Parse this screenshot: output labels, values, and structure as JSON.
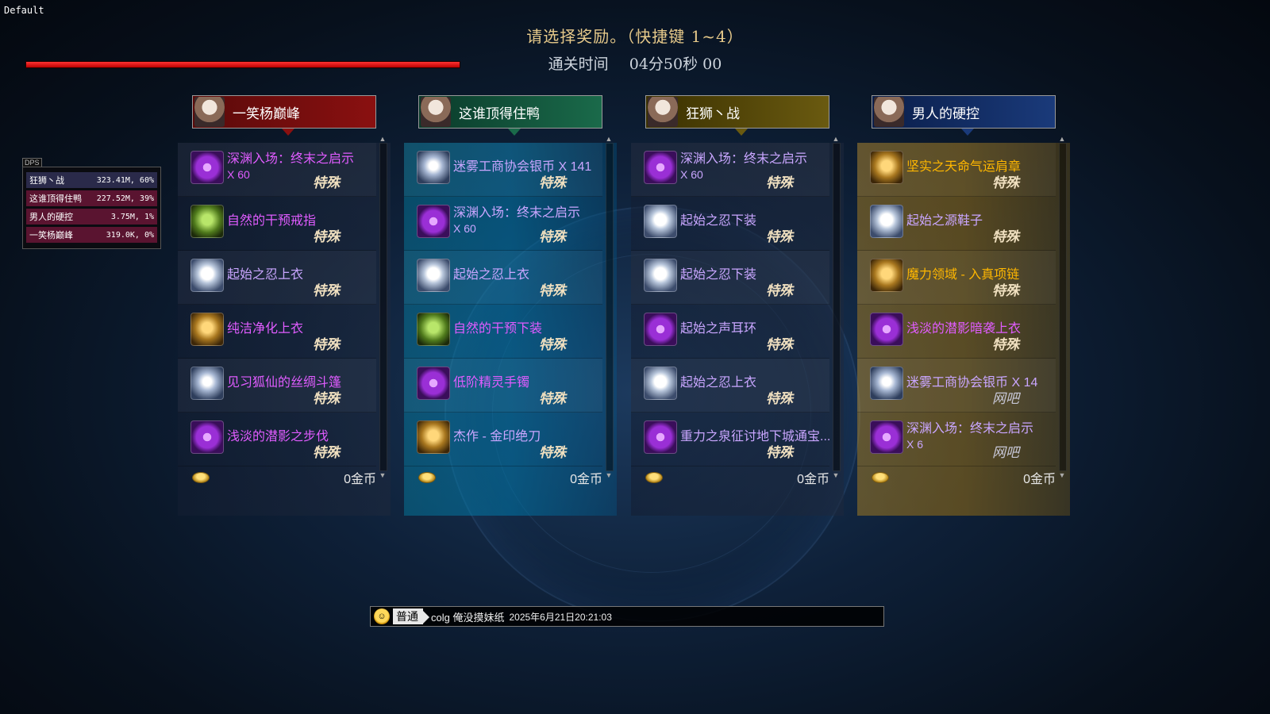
{
  "window_label": "Default",
  "hp_fill_percent": 100,
  "title": "请选择奖励。（快捷键 1~4）",
  "time_label": "通关时间",
  "time_value": "04分50秒 00",
  "dps": {
    "tag": "DPS",
    "rows": [
      {
        "name": "狂狮丶战",
        "value": "323.41M, 60%",
        "color": "#2a2a4a"
      },
      {
        "name": "这谁顶得住鸭",
        "value": "227.52M, 39%",
        "color": "#5a1430"
      },
      {
        "name": "男人的硬控",
        "value": "3.75M, 1%",
        "color": "#5a1430"
      },
      {
        "name": "一笑杨巅峰",
        "value": "319.0K, 0%",
        "color": "#5a1430"
      }
    ]
  },
  "columns": [
    {
      "player": "一笑杨巅峰",
      "head_bg": "#5a0a0a",
      "head_color": "#8a1010",
      "gold": "0金币",
      "items": [
        {
          "name": "深渊入场：终末之启示",
          "qty": "X 60",
          "color": "#e05cff",
          "tag": "特殊",
          "icon": "purple"
        },
        {
          "name": "自然的干预戒指",
          "qty": "",
          "color": "#e05cff",
          "tag": "特殊",
          "icon": "green"
        },
        {
          "name": "起始之忍上衣",
          "qty": "",
          "color": "#c9a6ff",
          "tag": "特殊",
          "icon": "white"
        },
        {
          "name": "纯洁净化上衣",
          "qty": "",
          "color": "#e05cff",
          "tag": "特殊",
          "icon": "gold"
        },
        {
          "name": "见习狐仙的丝绸斗篷",
          "qty": "",
          "color": "#e05cff",
          "tag": "特殊",
          "icon": "coin"
        },
        {
          "name": "浅淡的潜影之步伐",
          "qty": "",
          "color": "#e05cff",
          "tag": "特殊",
          "icon": "purple"
        }
      ]
    },
    {
      "player": "这谁顶得住鸭",
      "head_bg": "#0a3a2a",
      "head_color": "#1a6a4a",
      "gold": "0金币",
      "items": [
        {
          "name": "迷雾工商协会银币 X 141",
          "qty": "",
          "color": "#c9a6ff",
          "tag": "特殊",
          "icon": "coin"
        },
        {
          "name": "深渊入场：终末之启示",
          "qty": "X 60",
          "color": "#c9a6ff",
          "tag": "特殊",
          "icon": "purple"
        },
        {
          "name": "起始之忍上衣",
          "qty": "",
          "color": "#c9a6ff",
          "tag": "特殊",
          "icon": "white"
        },
        {
          "name": "自然的干预下装",
          "qty": "",
          "color": "#e05cff",
          "tag": "特殊",
          "icon": "green"
        },
        {
          "name": "低阶精灵手镯",
          "qty": "",
          "color": "#e05cff",
          "tag": "特殊",
          "icon": "purple"
        },
        {
          "name": "杰作 - 金印绝刀",
          "qty": "",
          "color": "#c9a6ff",
          "tag": "特殊",
          "icon": "gold"
        }
      ]
    },
    {
      "player": "狂狮丶战",
      "head_bg": "#3a3000",
      "head_color": "#6a5a10",
      "gold": "0金币",
      "items": [
        {
          "name": "深渊入场：终末之启示",
          "qty": "X 60",
          "color": "#c9a6ff",
          "tag": "特殊",
          "icon": "purple"
        },
        {
          "name": "起始之忍下装",
          "qty": "",
          "color": "#c9a6ff",
          "tag": "特殊",
          "icon": "white"
        },
        {
          "name": "起始之忍下装",
          "qty": "",
          "color": "#c9a6ff",
          "tag": "特殊",
          "icon": "white"
        },
        {
          "name": "起始之声耳环",
          "qty": "",
          "color": "#c9a6ff",
          "tag": "特殊",
          "icon": "purple"
        },
        {
          "name": "起始之忍上衣",
          "qty": "",
          "color": "#c9a6ff",
          "tag": "特殊",
          "icon": "white"
        },
        {
          "name": "重力之泉征讨地下城通宝...",
          "qty": "",
          "color": "#c9a6ff",
          "tag": "特殊",
          "icon": "purple"
        }
      ]
    },
    {
      "player": "男人的硬控",
      "head_bg": "#0a1e4a",
      "head_color": "#1a3a7a",
      "gold": "0金币",
      "items": [
        {
          "name": "坚实之天命气运肩章",
          "qty": "",
          "color": "#ffb700",
          "tag": "特殊",
          "icon": "gold"
        },
        {
          "name": "起始之源鞋子",
          "qty": "",
          "color": "#c9a6ff",
          "tag": "特殊",
          "icon": "white"
        },
        {
          "name": "魔力领域 - 入真项链",
          "qty": "",
          "color": "#ffb700",
          "tag": "特殊",
          "icon": "gold"
        },
        {
          "name": "浅淡的潜影暗袭上衣",
          "qty": "",
          "color": "#e05cff",
          "tag": "特殊",
          "icon": "purple"
        },
        {
          "name": "迷雾工商协会银币 X 14",
          "qty": "",
          "color": "#c9a6ff",
          "tag": "网吧",
          "icon": "coin"
        },
        {
          "name": "深渊入场：终末之启示",
          "qty": "X 6",
          "color": "#c9a6ff",
          "tag": "网吧",
          "icon": "purple"
        }
      ]
    }
  ],
  "chat": {
    "channel": "普通",
    "sender": "colg 俺没摸妹纸",
    "timestamp": "2025年6月21日20:21:03"
  }
}
